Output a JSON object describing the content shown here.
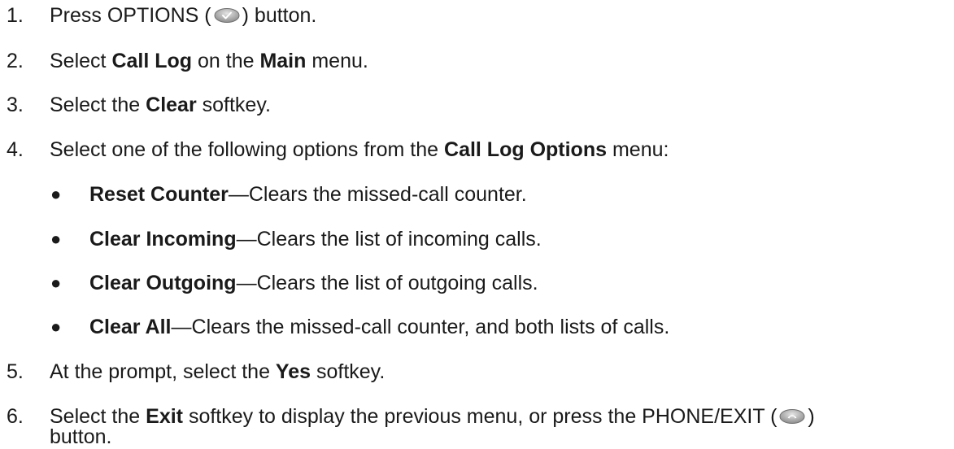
{
  "steps": [
    {
      "num": "1.",
      "pre": "Press OPTIONS (",
      "icon": "options-button-icon",
      "post": ") button."
    },
    {
      "num": "2.",
      "t1": "Select ",
      "b1": "Call Log",
      "t2": " on the ",
      "b2": "Main",
      "t3": " menu."
    },
    {
      "num": "3.",
      "t1": "Select the ",
      "b1": "Clear",
      "t2": " softkey."
    },
    {
      "num": "4.",
      "t1": "Select one of the following options from the ",
      "b1": "Call Log Options",
      "t2": " menu:"
    },
    {
      "num": "5.",
      "t1": "At the prompt, select the ",
      "b1": "Yes",
      "t2": " softkey."
    },
    {
      "num": "6.",
      "t1": "Select the ",
      "b1": "Exit",
      "t2": " softkey to display the previous menu, or press the PHONE/EXIT (",
      "icon": "phone-exit-button-icon",
      "t3": ")",
      "line2": "button."
    }
  ],
  "options": [
    {
      "term": "Reset Counter",
      "desc": "—Clears the missed-call counter."
    },
    {
      "term": "Clear Incoming",
      "desc": "—Clears the list of incoming calls."
    },
    {
      "term": "Clear Outgoing",
      "desc": "—Clears the list of outgoing calls."
    },
    {
      "term": "Clear All",
      "desc": "—Clears the missed-call counter, and both lists of calls."
    }
  ],
  "bullet_glyph": "●"
}
